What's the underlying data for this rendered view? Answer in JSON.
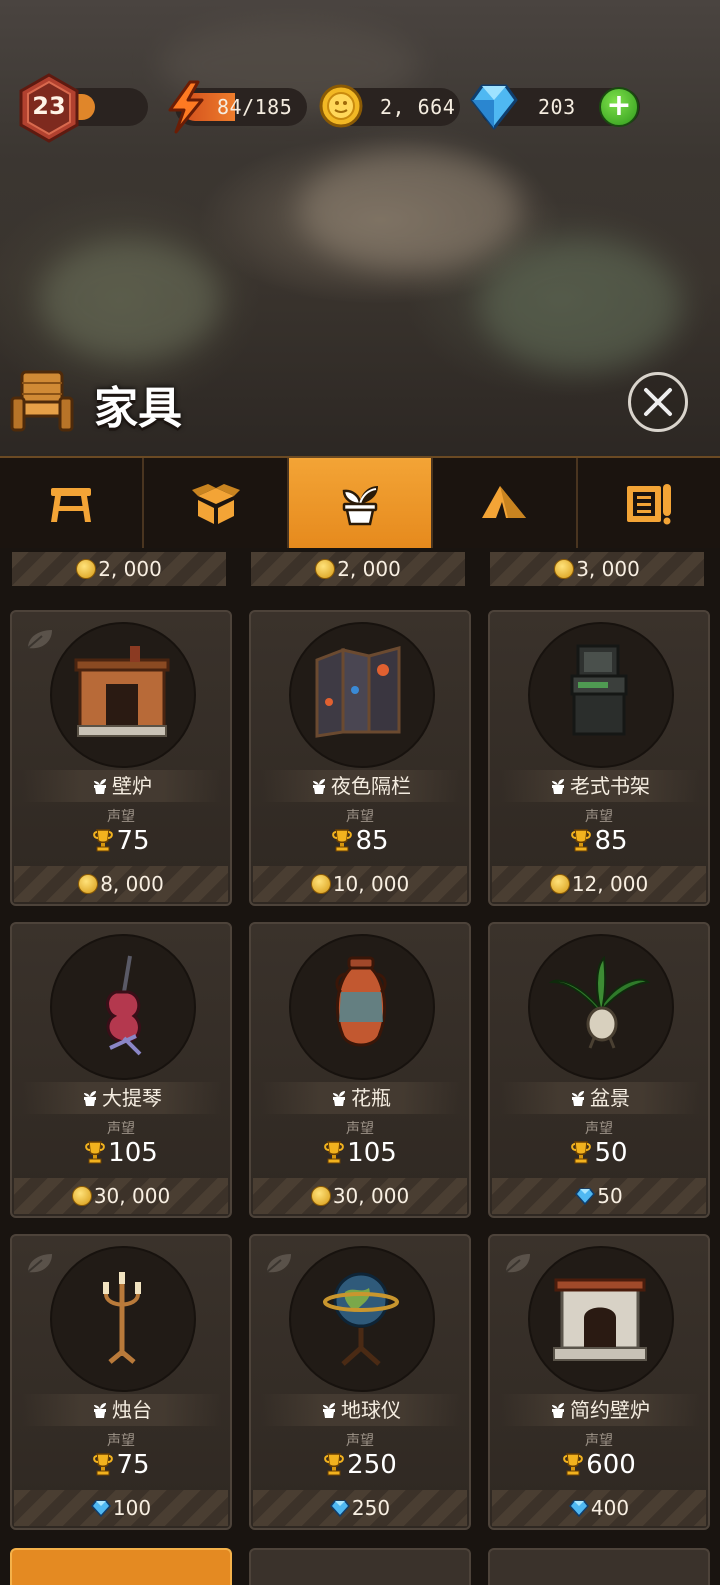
{
  "status": {
    "level": "23",
    "xp_fraction": 0.3,
    "energy_text": "84/185",
    "energy_fraction": 0.45,
    "coins": "2, 664",
    "gems": "203"
  },
  "header": {
    "title": "家具"
  },
  "tabs": [
    {
      "icon": "table-icon",
      "active": false
    },
    {
      "icon": "box-icon",
      "active": false
    },
    {
      "icon": "plant-icon",
      "active": true
    },
    {
      "icon": "tent-icon",
      "active": false
    },
    {
      "icon": "scroll-icon",
      "active": false
    }
  ],
  "partial_row": [
    {
      "price": "2, 000",
      "currency": "coin"
    },
    {
      "price": "2, 000",
      "currency": "coin"
    },
    {
      "price": "3, 000",
      "currency": "coin"
    }
  ],
  "items": [
    {
      "name": "壁炉",
      "prestige_label": "声望",
      "prestige": "75",
      "price": "8, 000",
      "currency": "coin",
      "leaf": true
    },
    {
      "name": "夜色隔栏",
      "prestige_label": "声望",
      "prestige": "85",
      "price": "10, 000",
      "currency": "coin",
      "leaf": false
    },
    {
      "name": "老式书架",
      "prestige_label": "声望",
      "prestige": "85",
      "price": "12, 000",
      "currency": "coin",
      "leaf": false
    },
    {
      "name": "大提琴",
      "prestige_label": "声望",
      "prestige": "105",
      "price": "30, 000",
      "currency": "coin",
      "leaf": false
    },
    {
      "name": "花瓶",
      "prestige_label": "声望",
      "prestige": "105",
      "price": "30, 000",
      "currency": "coin",
      "leaf": false
    },
    {
      "name": "盆景",
      "prestige_label": "声望",
      "prestige": "50",
      "price": "50",
      "currency": "gem",
      "leaf": false
    },
    {
      "name": "烛台",
      "prestige_label": "声望",
      "prestige": "75",
      "price": "100",
      "currency": "gem",
      "leaf": true
    },
    {
      "name": "地球仪",
      "prestige_label": "声望",
      "prestige": "250",
      "price": "250",
      "currency": "gem",
      "leaf": true
    },
    {
      "name": "简约壁炉",
      "prestige_label": "声望",
      "prestige": "600",
      "price": "400",
      "currency": "gem",
      "leaf": true
    }
  ],
  "colors": {
    "accent": "#e68a1d",
    "panel": "#2f2822",
    "background": "#191410"
  }
}
